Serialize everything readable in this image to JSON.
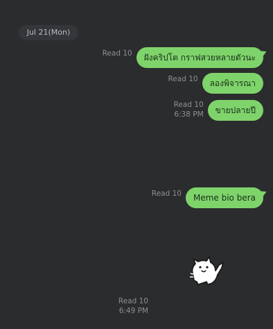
{
  "date_separator": "Jul 21(Mon)",
  "messages": [
    {
      "read": "Read 10",
      "time": "",
      "text": "ฝังคริปโต กราฟสวยหลายตัวนะ"
    },
    {
      "read": "Read 10",
      "time": "",
      "text": "ลองพิจารณา"
    },
    {
      "read": "Read 10",
      "time": "6:38 PM",
      "text": "ขายปลายปี"
    },
    {
      "read": "Read 10",
      "time": "",
      "text": "Meme bio bera"
    }
  ],
  "sticker": {
    "icon": "cat-sticker-icon",
    "read": "Read 10",
    "time": "6:49 PM"
  },
  "colors": {
    "background": "#2b2c2e",
    "bubble": "#7fd36b",
    "meta": "#8c8f94"
  }
}
